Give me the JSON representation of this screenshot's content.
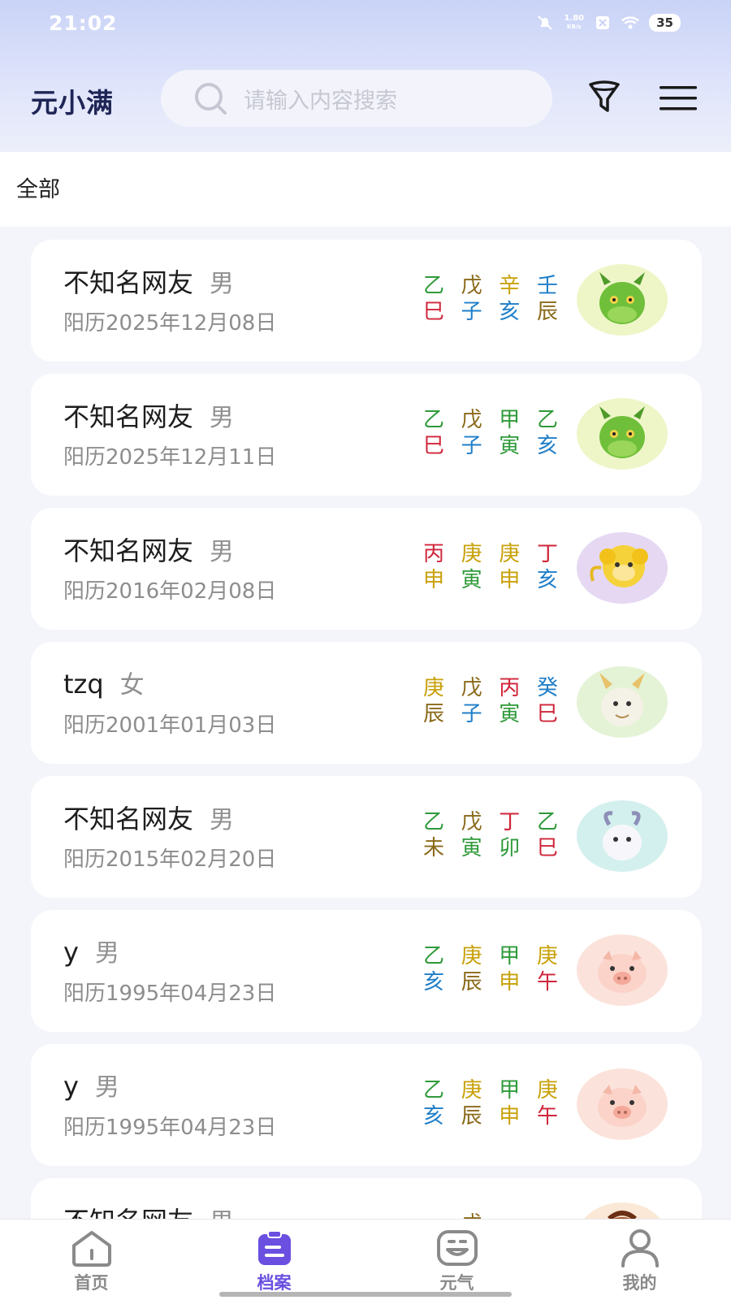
{
  "status_bar": {
    "time": "21:02",
    "net_speed_top": "1.80",
    "net_speed_bottom": "KB/s",
    "battery": "35"
  },
  "header": {
    "logo": "元小满",
    "search": {
      "placeholder": "请输入内容搜索"
    },
    "filter_icon": "filter-icon",
    "menu_icon": "menu-icon"
  },
  "filter_bar": {
    "label": "全部"
  },
  "records": [
    {
      "name": "不知名网友",
      "gender": "男",
      "date": "阳历2025年12月08日",
      "stems": [
        {
          "c": "乙",
          "color": "#2f9a3a"
        },
        {
          "c": "戊",
          "color": "#8a6a1a"
        },
        {
          "c": "辛",
          "color": "#c8a10a"
        },
        {
          "c": "壬",
          "color": "#1f7ec8"
        }
      ],
      "branches": [
        {
          "c": "巳",
          "color": "#d0263a"
        },
        {
          "c": "子",
          "color": "#1f7ec8"
        },
        {
          "c": "亥",
          "color": "#1f7ec8"
        },
        {
          "c": "辰",
          "color": "#8a6a1a"
        }
      ],
      "avatar": "green-dragon-avatar"
    },
    {
      "name": "不知名网友",
      "gender": "男",
      "date": "阳历2025年12月11日",
      "stems": [
        {
          "c": "乙",
          "color": "#2f9a3a"
        },
        {
          "c": "戊",
          "color": "#8a6a1a"
        },
        {
          "c": "甲",
          "color": "#2f9a3a"
        },
        {
          "c": "乙",
          "color": "#2f9a3a"
        }
      ],
      "branches": [
        {
          "c": "巳",
          "color": "#d0263a"
        },
        {
          "c": "子",
          "color": "#1f7ec8"
        },
        {
          "c": "寅",
          "color": "#2f9a3a"
        },
        {
          "c": "亥",
          "color": "#1f7ec8"
        }
      ],
      "avatar": "green-dragon-avatar"
    },
    {
      "name": "不知名网友",
      "gender": "男",
      "date": "阳历2016年02月08日",
      "stems": [
        {
          "c": "丙",
          "color": "#d0263a"
        },
        {
          "c": "庚",
          "color": "#c8a10a"
        },
        {
          "c": "庚",
          "color": "#c8a10a"
        },
        {
          "c": "丁",
          "color": "#d0263a"
        }
      ],
      "branches": [
        {
          "c": "申",
          "color": "#c8a10a"
        },
        {
          "c": "寅",
          "color": "#2f9a3a"
        },
        {
          "c": "申",
          "color": "#c8a10a"
        },
        {
          "c": "亥",
          "color": "#1f7ec8"
        }
      ],
      "avatar": "yellow-monkey-avatar"
    },
    {
      "name": "tzq",
      "gender": "女",
      "date": "阳历2001年01月03日",
      "stems": [
        {
          "c": "庚",
          "color": "#c8a10a"
        },
        {
          "c": "戊",
          "color": "#8a6a1a"
        },
        {
          "c": "丙",
          "color": "#d0263a"
        },
        {
          "c": "癸",
          "color": "#1f7ec8"
        }
      ],
      "branches": [
        {
          "c": "辰",
          "color": "#8a6a1a"
        },
        {
          "c": "子",
          "color": "#1f7ec8"
        },
        {
          "c": "寅",
          "color": "#2f9a3a"
        },
        {
          "c": "巳",
          "color": "#d0263a"
        }
      ],
      "avatar": "white-dragon-avatar"
    },
    {
      "name": "不知名网友",
      "gender": "男",
      "date": "阳历2015年02月20日",
      "stems": [
        {
          "c": "乙",
          "color": "#2f9a3a"
        },
        {
          "c": "戊",
          "color": "#8a6a1a"
        },
        {
          "c": "丁",
          "color": "#d0263a"
        },
        {
          "c": "乙",
          "color": "#2f9a3a"
        }
      ],
      "branches": [
        {
          "c": "未",
          "color": "#8a6a1a"
        },
        {
          "c": "寅",
          "color": "#2f9a3a"
        },
        {
          "c": "卯",
          "color": "#2f9a3a"
        },
        {
          "c": "巳",
          "color": "#d0263a"
        }
      ],
      "avatar": "white-goat-avatar"
    },
    {
      "name": "y",
      "gender": "男",
      "date": "阳历1995年04月23日",
      "stems": [
        {
          "c": "乙",
          "color": "#2f9a3a"
        },
        {
          "c": "庚",
          "color": "#c8a10a"
        },
        {
          "c": "甲",
          "color": "#2f9a3a"
        },
        {
          "c": "庚",
          "color": "#c8a10a"
        }
      ],
      "branches": [
        {
          "c": "亥",
          "color": "#1f7ec8"
        },
        {
          "c": "辰",
          "color": "#8a6a1a"
        },
        {
          "c": "申",
          "color": "#c8a10a"
        },
        {
          "c": "午",
          "color": "#d0263a"
        }
      ],
      "avatar": "pink-pig-avatar"
    },
    {
      "name": "y",
      "gender": "男",
      "date": "阳历1995年04月23日",
      "stems": [
        {
          "c": "乙",
          "color": "#2f9a3a"
        },
        {
          "c": "庚",
          "color": "#c8a10a"
        },
        {
          "c": "甲",
          "color": "#2f9a3a"
        },
        {
          "c": "庚",
          "color": "#c8a10a"
        }
      ],
      "branches": [
        {
          "c": "亥",
          "color": "#1f7ec8"
        },
        {
          "c": "辰",
          "color": "#8a6a1a"
        },
        {
          "c": "申",
          "color": "#c8a10a"
        },
        {
          "c": "午",
          "color": "#d0263a"
        }
      ],
      "avatar": "pink-pig-avatar"
    },
    {
      "name": "不知名网友",
      "gender": "男",
      "date": "",
      "stems": [
        {
          "c": "",
          "color": "#2f9a3a"
        },
        {
          "c": "戊",
          "color": "#8a6a1a"
        },
        {
          "c": "",
          "color": "#d0263a"
        },
        {
          "c": "",
          "color": "#d0263a"
        }
      ],
      "branches": [
        {
          "c": "",
          "color": "#2f9a3a"
        },
        {
          "c": "",
          "color": "#2f9a3a"
        },
        {
          "c": "",
          "color": "#2f9a3a"
        },
        {
          "c": "",
          "color": "#2f9a3a"
        }
      ],
      "avatar": "brown-horse-avatar"
    }
  ],
  "bottom_nav": [
    {
      "label": "首页",
      "icon": "home-icon",
      "active": false
    },
    {
      "label": "档案",
      "icon": "clipboard-icon",
      "active": true
    },
    {
      "label": "元气",
      "icon": "smile-face-icon",
      "active": false
    },
    {
      "label": "我的",
      "icon": "user-icon",
      "active": false
    }
  ],
  "colors": {
    "accent": "#6a4fe0",
    "header_gradient_top": "#c9d3f6",
    "wood": "#2f9a3a",
    "fire": "#d0263a",
    "earth": "#8a6a1a",
    "metal": "#c8a10a",
    "water": "#1f7ec8"
  }
}
